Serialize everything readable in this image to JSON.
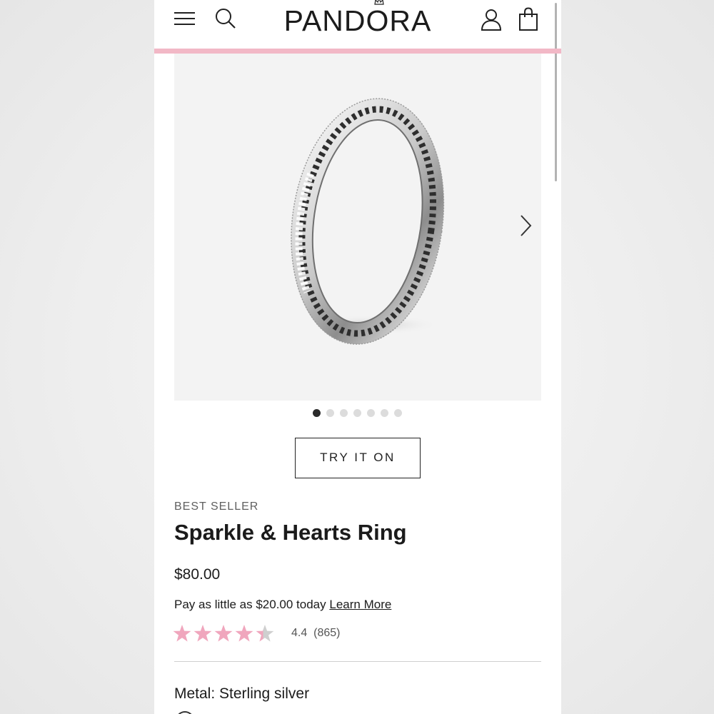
{
  "header": {
    "brand": "PANDORA",
    "icons": [
      "menu-icon",
      "search-icon",
      "account-icon",
      "shopping-bag-icon"
    ],
    "accent_color": "#f2b8c6"
  },
  "gallery": {
    "image": "sparkle-hearts-ring-photo",
    "next_icon": "chevron-right-icon",
    "total_images": 7,
    "active_index": 0
  },
  "try_on": {
    "label": "TRY IT ON"
  },
  "product": {
    "badge": "BEST SELLER",
    "title": "Sparkle & Hearts Ring",
    "price": "$80.00",
    "installment_text": "Pay as little as $20.00 today",
    "installment_link": "Learn More",
    "rating": {
      "value": 4.4,
      "display": "4.4",
      "count": "(865)",
      "star_color": "#f0a6bd"
    },
    "metal_label": "Metal: Sterling silver"
  }
}
